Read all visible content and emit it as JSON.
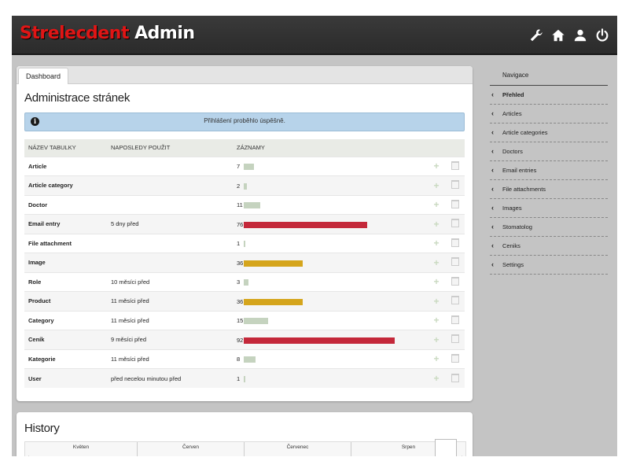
{
  "brand": {
    "part1": "Strelecdent",
    "part2": "Admin"
  },
  "toolbar_icons": [
    "wrench-icon",
    "home-icon",
    "user-icon",
    "power-icon"
  ],
  "tab": {
    "label": "Dashboard"
  },
  "main": {
    "title": "Administrace stránek",
    "alert": "Přihlášení proběhlo úspěšně.",
    "columns": [
      "NÁZEV TABULKY",
      "NAPOSLEDY POUŽIT",
      "ZÁZNAMY"
    ],
    "rows": [
      {
        "name": "Article",
        "last": "",
        "count": "7",
        "bar_fraction": 0.07,
        "bar_color": "#c5d3bf"
      },
      {
        "name": "Article category",
        "last": "",
        "count": "2",
        "bar_fraction": 0.02,
        "bar_color": "#c5d3bf"
      },
      {
        "name": "Doctor",
        "last": "",
        "count": "11",
        "bar_fraction": 0.11,
        "bar_color": "#c5d3bf"
      },
      {
        "name": "Email entry",
        "last": "5 dny před",
        "count": "76",
        "bar_fraction": 0.82,
        "bar_color": "#c4283a"
      },
      {
        "name": "File attachment",
        "last": "",
        "count": "1",
        "bar_fraction": 0.01,
        "bar_color": "#c5d3bf"
      },
      {
        "name": "Image",
        "last": "",
        "count": "36",
        "bar_fraction": 0.39,
        "bar_color": "#d5a51c"
      },
      {
        "name": "Role",
        "last": "10 měsíci před",
        "count": "3",
        "bar_fraction": 0.03,
        "bar_color": "#c5d3bf"
      },
      {
        "name": "Product",
        "last": "11 měsíci před",
        "count": "36",
        "bar_fraction": 0.39,
        "bar_color": "#d5a51c"
      },
      {
        "name": "Category",
        "last": "11 měsíci před",
        "count": "15",
        "bar_fraction": 0.16,
        "bar_color": "#c5d3bf"
      },
      {
        "name": "Ceník",
        "last": "9 měsíci před",
        "count": "92",
        "bar_fraction": 1.0,
        "bar_color": "#c4283a"
      },
      {
        "name": "Kategorie",
        "last": "11 měsíci před",
        "count": "8",
        "bar_fraction": 0.08,
        "bar_color": "#c5d3bf"
      },
      {
        "name": "User",
        "last": "před necelou minutou před",
        "count": "1",
        "bar_fraction": 0.01,
        "bar_color": "#c5d3bf"
      }
    ]
  },
  "history": {
    "title": "History",
    "months": [
      "Květen",
      "Červen",
      "Červenec",
      "Srpen"
    ]
  },
  "sidenav": {
    "heading": "Navigace",
    "items": [
      "Přehled",
      "Articles",
      "Article categories",
      "Doctors",
      "Email entries",
      "File attachments",
      "Images",
      "Stomatolog",
      "Ceniks",
      "Settings"
    ],
    "active_index": 0
  }
}
